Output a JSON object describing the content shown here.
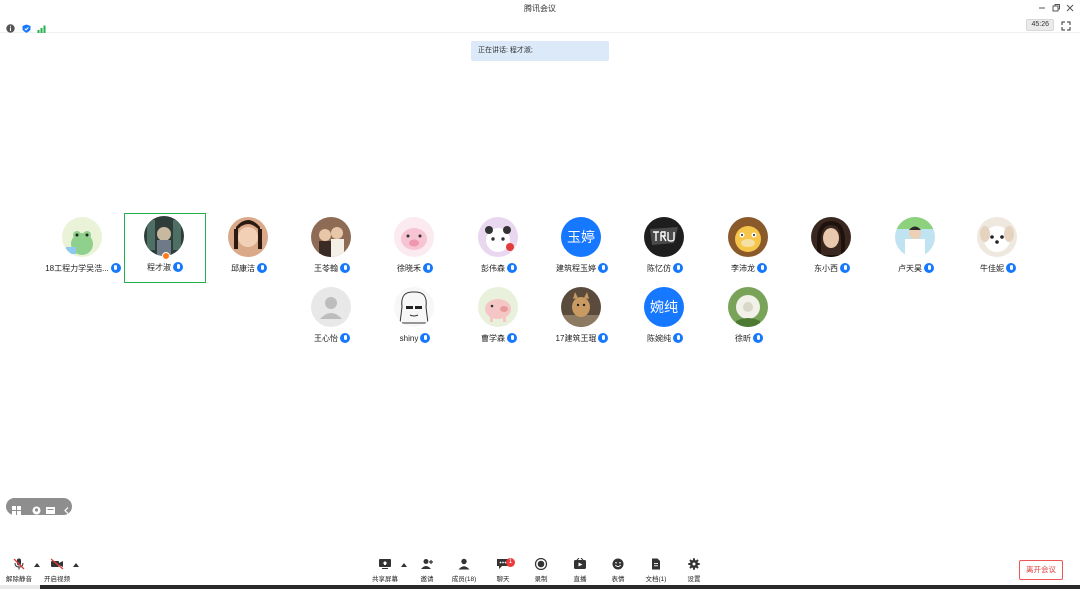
{
  "window": {
    "title": "腾讯会议"
  },
  "status": {
    "timer": "45:26"
  },
  "banner": {
    "speaking": "正在讲话: 程才淑;"
  },
  "participants": [
    {
      "name": "18工程力学吴浩...",
      "avatar": "frog"
    },
    {
      "name": "程才淑",
      "avatar": "dark",
      "active": true
    },
    {
      "name": "邱康洁",
      "avatar": "girl"
    },
    {
      "name": "王苓翰",
      "avatar": "couple"
    },
    {
      "name": "徐晓禾",
      "avatar": "pig-pink"
    },
    {
      "name": "彭伟森",
      "avatar": "panda-bear"
    },
    {
      "name": "建筑程玉婷",
      "avatar_text": "玉婷"
    },
    {
      "name": "陈忆仿",
      "avatar": "true-dark"
    },
    {
      "name": "李沛龙",
      "avatar": "psyduck"
    },
    {
      "name": "东小西",
      "avatar": "woman"
    },
    {
      "name": "卢天昊",
      "avatar": "man-white"
    },
    {
      "name": "牛佳妮",
      "avatar": "dog"
    },
    {
      "name": "王心怡",
      "avatar": "default"
    },
    {
      "name": "shiny",
      "avatar": "sketch"
    },
    {
      "name": "曹学森",
      "avatar": "pig-cartoon"
    },
    {
      "name": "17建筑王琨",
      "avatar": "cat"
    },
    {
      "name": "陈婉纯",
      "avatar_text": "婉纯"
    },
    {
      "name": "徐昕",
      "avatar": "flower"
    }
  ],
  "toolbar": {
    "unmute": "解除静音",
    "start_video": "开启视频",
    "share_screen": "共享屏幕",
    "invite": "邀请",
    "members": "成员(18)",
    "chat": "聊天",
    "chat_badge": "1",
    "record": "录制",
    "live": "直播",
    "reactions": "表情",
    "docs": "文档(1)",
    "settings": "设置",
    "leave": "离开会议"
  },
  "colors": {
    "accent": "#1677ff",
    "active_border": "#22b14c",
    "leave_red": "#e03c3c",
    "mic_red": "#e03c3c"
  }
}
